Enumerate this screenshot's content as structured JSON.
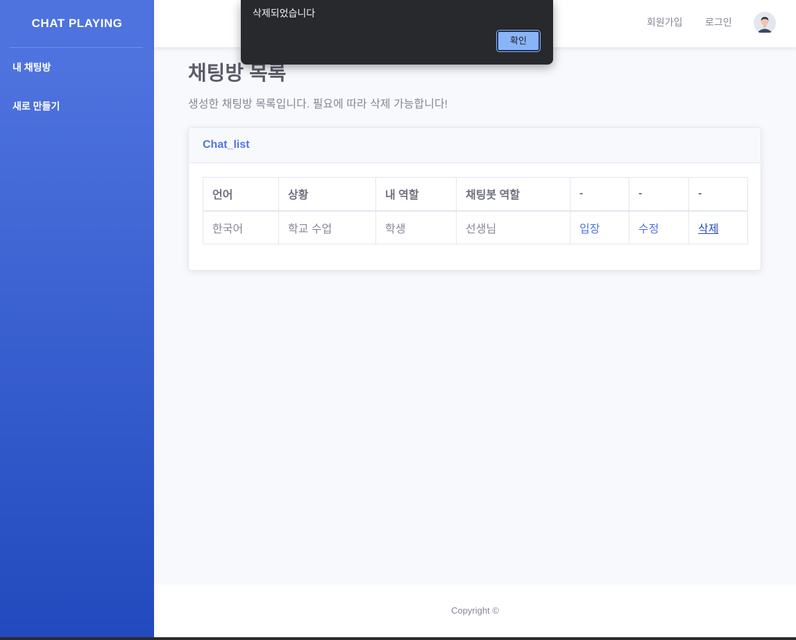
{
  "sidebar": {
    "brand": "CHAT PLAYING",
    "items": [
      {
        "label": "내 채팅방"
      },
      {
        "label": "새로 만들기"
      }
    ]
  },
  "topbar": {
    "signup": "회원가입",
    "login": "로그인",
    "avatar_icon": "user-avatar-icon"
  },
  "page": {
    "title": "채팅방 목록",
    "description": "생성한 채팅방 목록입니다. 필요에 따라 삭제 가능합니다!"
  },
  "card": {
    "header": "Chat_list",
    "columns": [
      "언어",
      "상황",
      "내 역할",
      "채팅봇 역할",
      "-",
      "-",
      "-"
    ],
    "rows": [
      {
        "language": "한국어",
        "situation": "학교 수업",
        "my_role": "학생",
        "bot_role": "선생님",
        "enter": "입장",
        "edit": "수정",
        "delete": "삭제"
      }
    ]
  },
  "footer": {
    "copyright": "Copyright ©"
  },
  "dialog": {
    "message": "삭제되었습니다",
    "ok_label": "확인",
    "ok_color": "#8ab4f8"
  },
  "colors": {
    "primary": "#4e73df",
    "primary_dark": "#224abe",
    "text_muted": "#858796"
  }
}
